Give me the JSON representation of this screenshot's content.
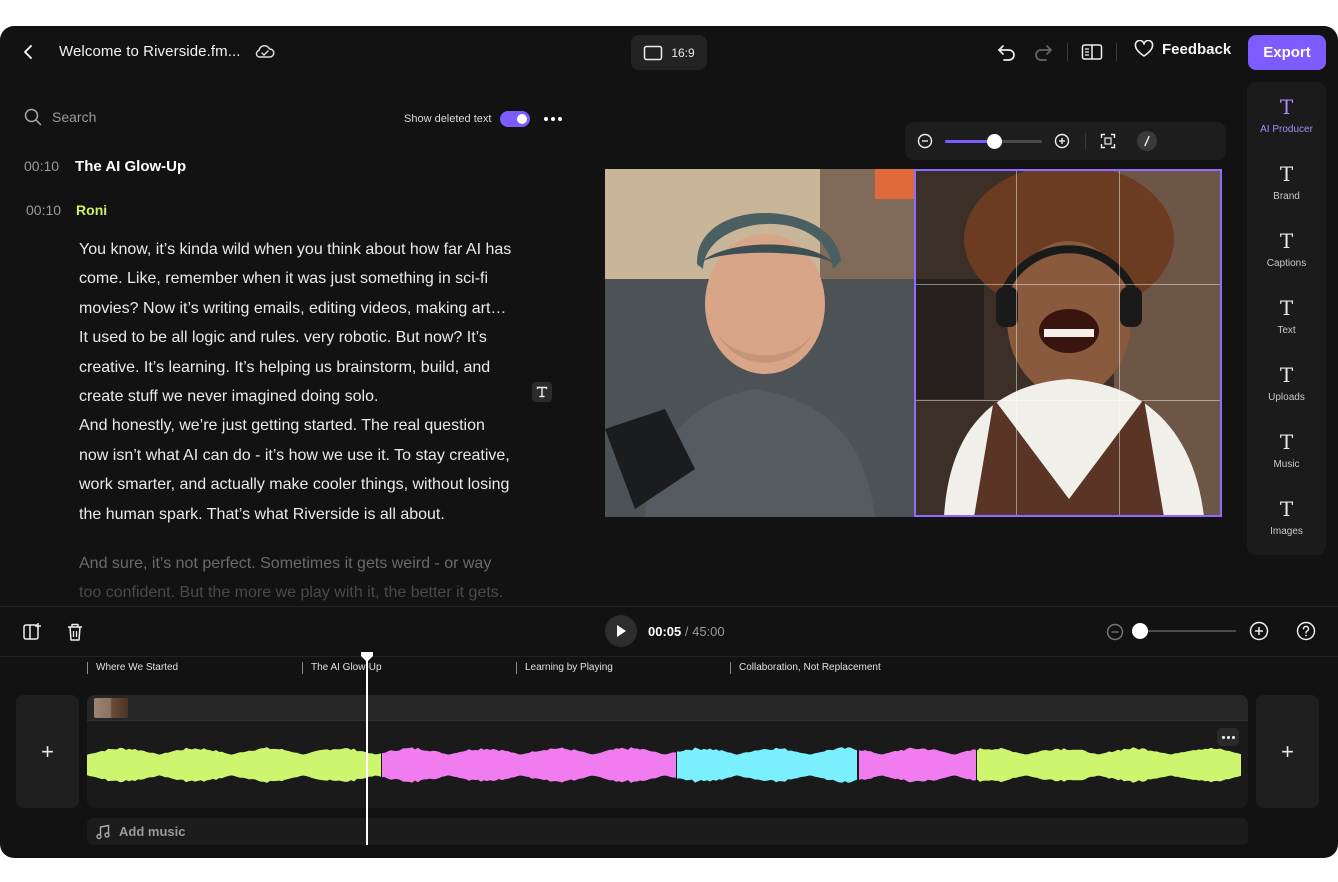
{
  "header": {
    "project_title": "Welcome to Riverside.fm...",
    "aspect_ratio": "16:9",
    "feedback_label": "Feedback",
    "export_label": "Export"
  },
  "transcript": {
    "search_placeholder": "Search",
    "show_deleted_label": "Show deleted text",
    "show_deleted_on": true,
    "chapter_time": "00:10",
    "chapter_title": "The AI Glow-Up",
    "speaker_time": "00:10",
    "speaker_name": "Roni",
    "lines": [
      "You know, it’s kinda wild when you think about how far AI has",
      "come. Like, remember when it was just something in sci-fi",
      "movies? Now it’s writing emails, editing videos, making art…",
      "It used to be all logic and rules. very robotic. But now? It’s",
      "creative. It’s learning. It’s helping us brainstorm, build, and",
      "create stuff we never imagined doing solo.",
      "And honestly, we’re just getting started. The real question",
      "now isn’t what AI can do - it’s how we use it. To stay creative,",
      "work smarter, and actually make cooler things, without losing",
      "the human spark. That’s what Riverside is all about."
    ],
    "dim_lines": [
      "And sure, it’s not perfect. Sometimes it gets weird - or way",
      "too confident.  But the more we play with it, the better it gets."
    ]
  },
  "preview": {
    "zoom_level": 0.5
  },
  "rail": {
    "items": [
      {
        "label": "AI Producer",
        "glyph": "T",
        "active": true
      },
      {
        "label": "Brand",
        "glyph": "T",
        "active": false
      },
      {
        "label": "Captions",
        "glyph": "T",
        "active": false
      },
      {
        "label": "Text",
        "glyph": "T",
        "active": false
      },
      {
        "label": "Uploads",
        "glyph": "T",
        "active": false
      },
      {
        "label": "Music",
        "glyph": "T",
        "active": false
      },
      {
        "label": "Images",
        "glyph": "T",
        "active": false
      }
    ]
  },
  "timeline": {
    "current_time": "00:05",
    "total_time": "/ 45:00",
    "zoom_level": 0.02,
    "chapters": [
      "Where We Started",
      "The AI Glow-Up",
      "Learning by Playing",
      "Collaboration, Not Replacement"
    ],
    "add_music_label": "Add music",
    "wave_colors": {
      "green": "#cdf56e",
      "pink": "#f07cf0",
      "cyan": "#7af0ff"
    }
  },
  "colors": {
    "accent": "#7c5cff",
    "speaker": "#c9f26a",
    "background": "#121212"
  }
}
